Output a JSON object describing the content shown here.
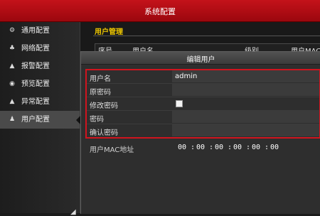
{
  "window": {
    "title": "系统配置"
  },
  "sidebar": {
    "items": [
      {
        "label": "通用配置",
        "icon": "gear-icon",
        "glyph": "⚙"
      },
      {
        "label": "网络配置",
        "icon": "network-icon",
        "glyph": "♣"
      },
      {
        "label": "报警配置",
        "icon": "alarm-icon",
        "glyph": "▲"
      },
      {
        "label": "预览配置",
        "icon": "eye-icon",
        "glyph": "◉"
      },
      {
        "label": "异常配置",
        "icon": "warning-icon",
        "glyph": "▲"
      },
      {
        "label": "用户配置",
        "icon": "users-icon",
        "glyph": "♟",
        "active": true
      }
    ]
  },
  "user_management": {
    "title": "用户管理",
    "columns": [
      "序号",
      "用户名",
      "级别",
      "用户MAC"
    ]
  },
  "dialog": {
    "title": "编辑用户",
    "fields": {
      "username": {
        "label": "用户名",
        "value": "admin"
      },
      "old_password": {
        "label": "原密码",
        "value": ""
      },
      "change_password": {
        "label": "修改密码"
      },
      "password": {
        "label": "密码",
        "value": ""
      },
      "confirm_password": {
        "label": "确认密码",
        "value": ""
      },
      "mac": {
        "label": "用户MAC地址",
        "segments": [
          "00",
          "00",
          "00",
          "00",
          "00",
          "00"
        ],
        "separator": ":"
      }
    }
  },
  "colors": {
    "title_bar": "#b30d15",
    "highlight": "#d0141e",
    "section_title": "#f0c800"
  }
}
